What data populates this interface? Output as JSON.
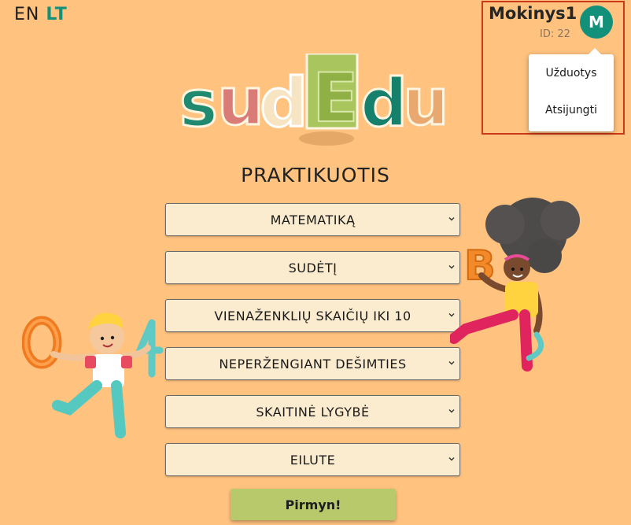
{
  "languages": {
    "en": "EN",
    "lt": "LT",
    "active": "LT"
  },
  "user": {
    "name": "Mokinys1",
    "id_label": "ID: 22",
    "avatar_letter": "M",
    "avatar_color": "#13907a",
    "menu": [
      "Užduotys",
      "Atsijungti"
    ]
  },
  "logo": {
    "letters": [
      "s",
      "u",
      "d",
      "E",
      "d",
      "u"
    ]
  },
  "page_title": "PRAKTIKUOTIS",
  "selects": [
    {
      "name": "subject-select",
      "value": "MATEMATIKĄ"
    },
    {
      "name": "operation-select",
      "value": "SUDĖTĮ"
    },
    {
      "name": "range-select",
      "value": "VIENAŽENKLIŲ SKAIČIŲ IKI 10"
    },
    {
      "name": "carry-select",
      "value": "NEPERŽENGIANT DEŠIMTIES"
    },
    {
      "name": "type-select",
      "value": "SKAITINĖ LYGYBĖ"
    },
    {
      "name": "format-select",
      "value": "EILUTE"
    }
  ],
  "go_button": "Pirmyn!",
  "colors": {
    "background": "#ffc27f",
    "accent": "#13907a",
    "select_bg": "#fbeccf",
    "button_bg": "#b8c96c",
    "highlight_border": "#cc3a1c"
  }
}
